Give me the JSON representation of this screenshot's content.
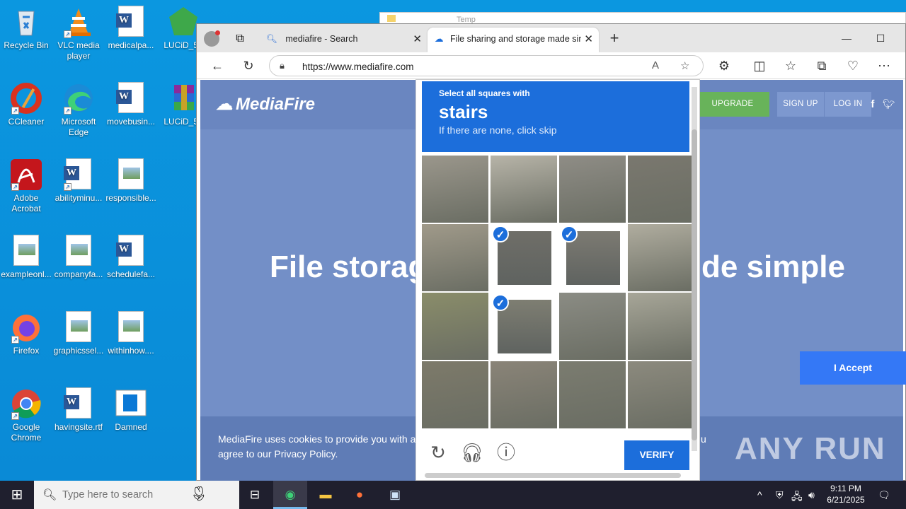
{
  "desktop": {
    "icons": [
      {
        "label": "Recycle Bin",
        "icon": "recycle-bin-icon"
      },
      {
        "label": "VLC media player",
        "icon": "vlc-icon"
      },
      {
        "label": "medicalpa...",
        "icon": "word-doc-icon"
      },
      {
        "label": "LUCiD_5e",
        "icon": "green-gem-icon"
      },
      {
        "label": "CCleaner",
        "icon": "ccleaner-icon"
      },
      {
        "label": "Microsoft Edge",
        "icon": "edge-icon"
      },
      {
        "label": "movebusin...",
        "icon": "word-doc-icon"
      },
      {
        "label": "LUCiD_5e",
        "icon": "winrar-icon"
      },
      {
        "label": "Adobe Acrobat",
        "icon": "acrobat-icon"
      },
      {
        "label": "abilityminu...",
        "icon": "word-doc-icon"
      },
      {
        "label": "responsible...",
        "icon": "image-file-icon"
      },
      {
        "label": "exampleonl...",
        "icon": "image-file-icon"
      },
      {
        "label": "companyfa...",
        "icon": "image-file-icon"
      },
      {
        "label": "schedulefa...",
        "icon": "word-doc-icon"
      },
      {
        "label": "Firefox",
        "icon": "firefox-icon"
      },
      {
        "label": "graphicssel...",
        "icon": "image-file-icon"
      },
      {
        "label": "withinhow....",
        "icon": "image-file-icon"
      },
      {
        "label": "Google Chrome",
        "icon": "chrome-icon"
      },
      {
        "label": "havingsite.rtf",
        "icon": "word-doc-icon"
      },
      {
        "label": "Damned",
        "icon": "app-window-icon"
      }
    ]
  },
  "background_window": {
    "title": "Temp"
  },
  "browser": {
    "tabs": [
      {
        "title": "mediafire - Search"
      },
      {
        "title": "File sharing and storage made sin"
      }
    ],
    "new_tab_label": "+",
    "url": "https://www.mediafire.com"
  },
  "mediafire": {
    "logo": "MediaFire",
    "upgrade": "UPGRADE",
    "signup": "SIGN UP",
    "login": "LOG IN",
    "hero_left": "File storag",
    "hero_right": "de simple",
    "cookie_line1": "MediaFire uses cookies to provide you with a p",
    "cookie_line2": "agree to our Privacy Policy.",
    "cookie_trailing": "u",
    "accept": "I Accept"
  },
  "captcha": {
    "instruction": "Select all squares with",
    "target": "stairs",
    "hint": "If there are none, click skip",
    "selected_tiles": [
      5,
      6,
      9
    ],
    "verify": "VERIFY"
  },
  "watermark": "ANY RUN",
  "taskbar": {
    "search_placeholder": "Type here to search",
    "time": "9:11 PM",
    "date": "6/21/2025"
  },
  "colors": {
    "captcha_blue": "#1c6edb",
    "desktop_blue": "#0a8fd8",
    "mediafire_bg": "#738fc7",
    "upgrade_green": "#68b35a"
  }
}
